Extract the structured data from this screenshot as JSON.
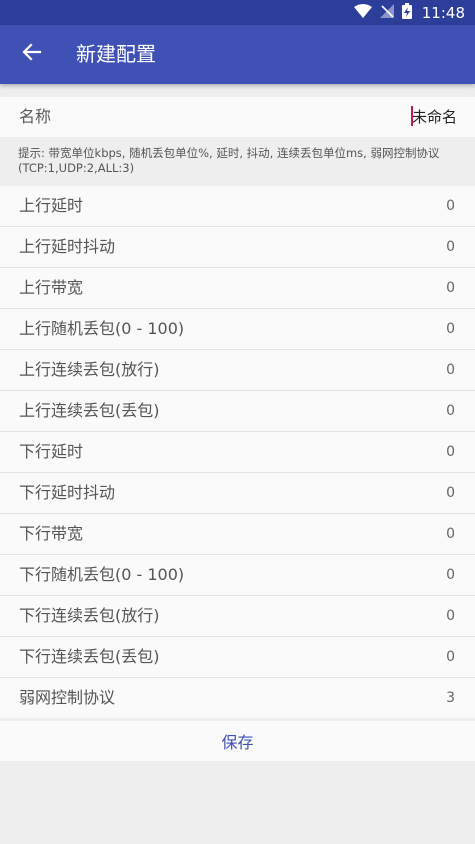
{
  "status_bar": {
    "time": "11:48"
  },
  "app_bar": {
    "title": "新建配置"
  },
  "name_field": {
    "label": "名称",
    "value": "未命名"
  },
  "hint": "提示: 带宽单位kbps, 随机丢包单位%, 延时, 抖动, 连续丢包单位ms, 弱网控制协议(TCP:1,UDP:2,ALL:3)",
  "settings": [
    {
      "label": "上行延时",
      "value": "0"
    },
    {
      "label": "上行延时抖动",
      "value": "0"
    },
    {
      "label": "上行带宽",
      "value": "0"
    },
    {
      "label": "上行随机丢包(0 - 100)",
      "value": "0"
    },
    {
      "label": "上行连续丢包(放行)",
      "value": "0"
    },
    {
      "label": "上行连续丢包(丢包)",
      "value": "0"
    },
    {
      "label": "下行延时",
      "value": "0"
    },
    {
      "label": "下行延时抖动",
      "value": "0"
    },
    {
      "label": "下行带宽",
      "value": "0"
    },
    {
      "label": "下行随机丢包(0 - 100)",
      "value": "0"
    },
    {
      "label": "下行连续丢包(放行)",
      "value": "0"
    },
    {
      "label": "下行连续丢包(丢包)",
      "value": "0"
    },
    {
      "label": "弱网控制协议",
      "value": "3"
    }
  ],
  "save_button": {
    "label": "保存"
  },
  "colors": {
    "primary": "#3f51b5",
    "primary_dark": "#2c3e9a",
    "cursor": "#c2185b"
  }
}
